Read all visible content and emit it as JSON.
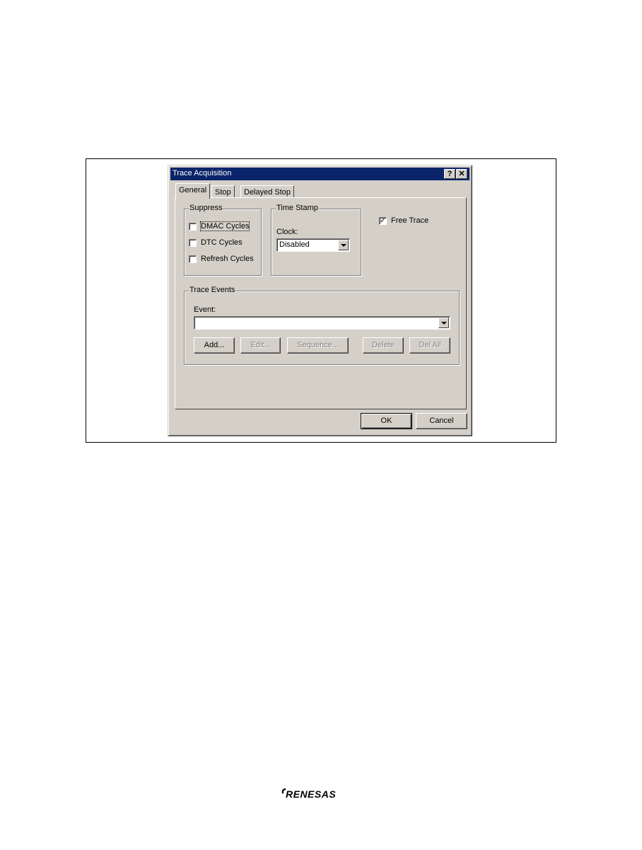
{
  "dialog": {
    "title": "Trace Acquisition",
    "help_button": "?",
    "close_button": "✕"
  },
  "tabs": [
    {
      "label": "General",
      "active": true
    },
    {
      "label": "Stop",
      "active": false
    },
    {
      "label": "Delayed Stop",
      "active": false
    }
  ],
  "suppress": {
    "label": "Suppress",
    "items": [
      {
        "label": "DMAC Cycles",
        "checked": false
      },
      {
        "label": "DTC Cycles",
        "checked": false
      },
      {
        "label": "Refresh Cycles",
        "checked": false
      }
    ]
  },
  "time_stamp": {
    "label": "Time Stamp",
    "clock_label": "Clock:",
    "clock_value": "Disabled"
  },
  "free_trace": {
    "label": "Free Trace",
    "checked": true,
    "mark": "✓"
  },
  "trace_events": {
    "label": "Trace Events",
    "event_label": "Event:",
    "event_value": "",
    "buttons": {
      "add": "Add...",
      "edit": "Edit...",
      "sequence": "Sequence...",
      "delete": "Delete",
      "del_all": "Del All"
    }
  },
  "footer": {
    "ok": "OK",
    "cancel": "Cancel"
  },
  "brand": {
    "logo_text": "RENESAS",
    "color": "#000000"
  },
  "colors": {
    "title_bar": "#0a246a",
    "dialog_face": "#d4d0c8"
  }
}
